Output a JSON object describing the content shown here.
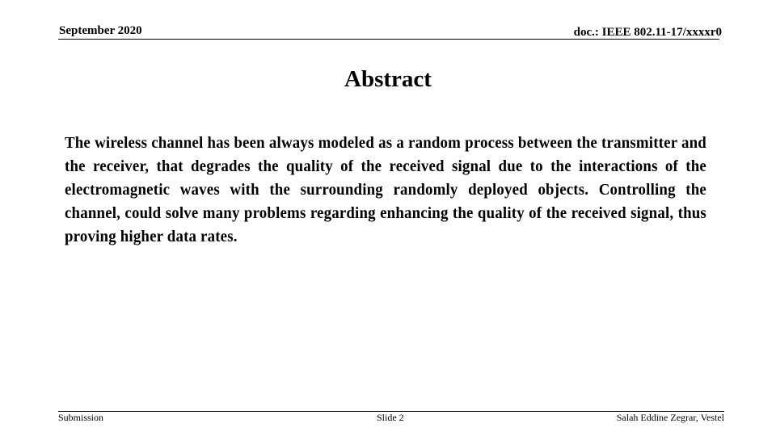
{
  "header": {
    "date": "September 2020",
    "doc_id": "doc.: IEEE 802.11-17/xxxxr0"
  },
  "slide": {
    "title": "Abstract",
    "body": "The wireless channel has been always modeled as a random process between the transmitter and the receiver, that degrades the quality of the received signal due to the interactions of the electromagnetic waves with the surrounding randomly deployed objects. Controlling the channel, could solve many problems regarding enhancing the quality of the received signal, thus proving higher data rates."
  },
  "footer": {
    "left": "Submission",
    "center": "Slide 2",
    "right": "Salah Eddine Zegrar, Vestel"
  }
}
